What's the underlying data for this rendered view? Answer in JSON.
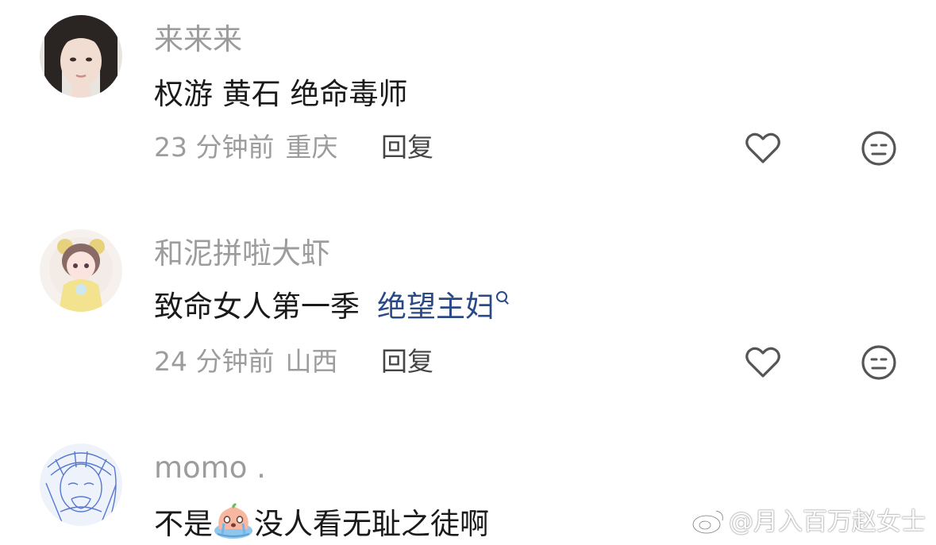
{
  "comments": [
    {
      "username": "来来来",
      "text": "权游 黄石 绝命毒师",
      "time": "23 分钟前",
      "location": "重庆",
      "reply_label": "回复",
      "avatar": "avatar-girl-dark-hair"
    },
    {
      "username": "和泥拼啦大虾",
      "text": "致命女人第一季",
      "link_text": "绝望主妇",
      "time": "24 分钟前",
      "location": "山西",
      "reply_label": "回复",
      "avatar": "avatar-anime-girl"
    },
    {
      "username": "momo .",
      "text_before": "不是",
      "text_after": "没人看无耻之徒啊",
      "avatar": "avatar-blue-sketch",
      "emoji": "crying-peach-emoji"
    }
  ],
  "watermark": {
    "text": "@月入百万赵女士",
    "icon": "weibo-logo-icon"
  },
  "icons": {
    "like": "heart-outline-icon",
    "dislike": "neutral-face-icon"
  },
  "colors": {
    "username": "#9c9c9c",
    "text": "#1a1a1a",
    "link": "#2a4a86",
    "meta": "#9c9c9c",
    "reply": "#454545"
  }
}
